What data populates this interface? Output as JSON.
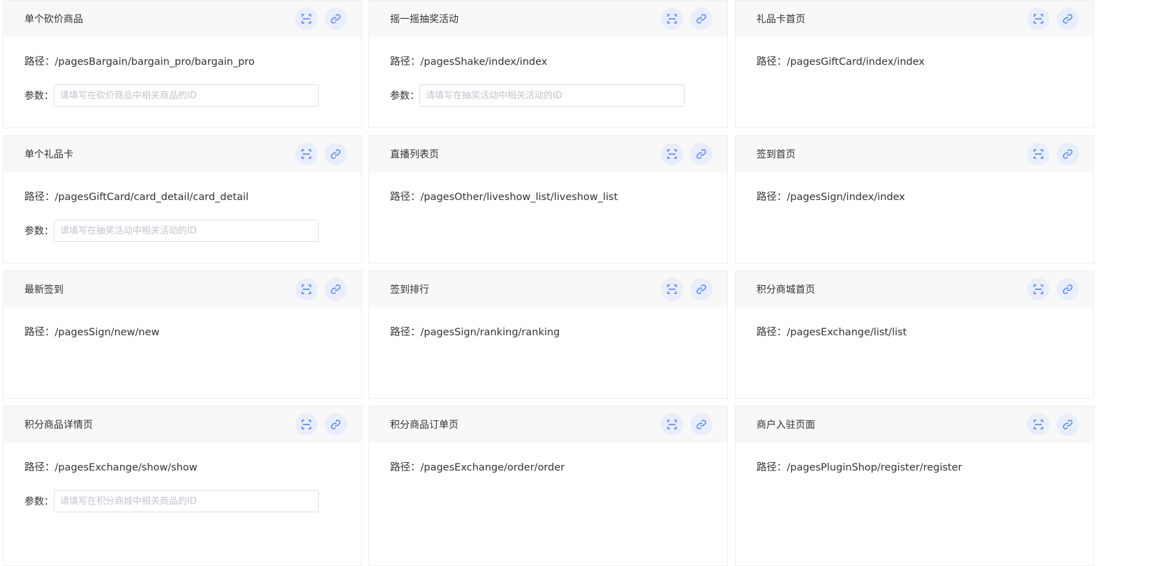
{
  "labels": {
    "path_prefix": "路径：",
    "param_label": "参数："
  },
  "icons": {
    "scan": "scan-icon",
    "link": "link-icon"
  },
  "colors": {
    "icon_bg": "#e8eefb",
    "icon_fg": "#4a7df0",
    "header_bg": "#f8f8f9"
  },
  "cards": [
    {
      "title": "单个砍价商品",
      "path": "/pagesBargain/bargain_pro/bargain_pro",
      "param_placeholder": "请填写在砍价商品中相关商品的ID"
    },
    {
      "title": "摇一摇抽奖活动",
      "path": "/pagesShake/index/index",
      "param_placeholder": "请填写在抽奖活动中相关活动的ID"
    },
    {
      "title": "礼品卡首页",
      "path": "/pagesGiftCard/index/index"
    },
    {
      "title": "单个礼品卡",
      "path": "/pagesGiftCard/card_detail/card_detail",
      "param_placeholder": "请填写在抽奖活动中相关活动的ID"
    },
    {
      "title": "直播列表页",
      "path": "/pagesOther/liveshow_list/liveshow_list"
    },
    {
      "title": "签到首页",
      "path": "/pagesSign/index/index"
    },
    {
      "title": "最新签到",
      "path": "/pagesSign/new/new"
    },
    {
      "title": "签到排行",
      "path": "/pagesSign/ranking/ranking"
    },
    {
      "title": "积分商城首页",
      "path": "/pagesExchange/list/list"
    },
    {
      "title": "积分商品详情页",
      "path": "/pagesExchange/show/show",
      "param_placeholder": "请填写在积分商城中相关商品的ID"
    },
    {
      "title": "积分商品订单页",
      "path": "/pagesExchange/order/order"
    },
    {
      "title": "商户入驻页面",
      "path": "/pagesPluginShop/register/register"
    }
  ]
}
